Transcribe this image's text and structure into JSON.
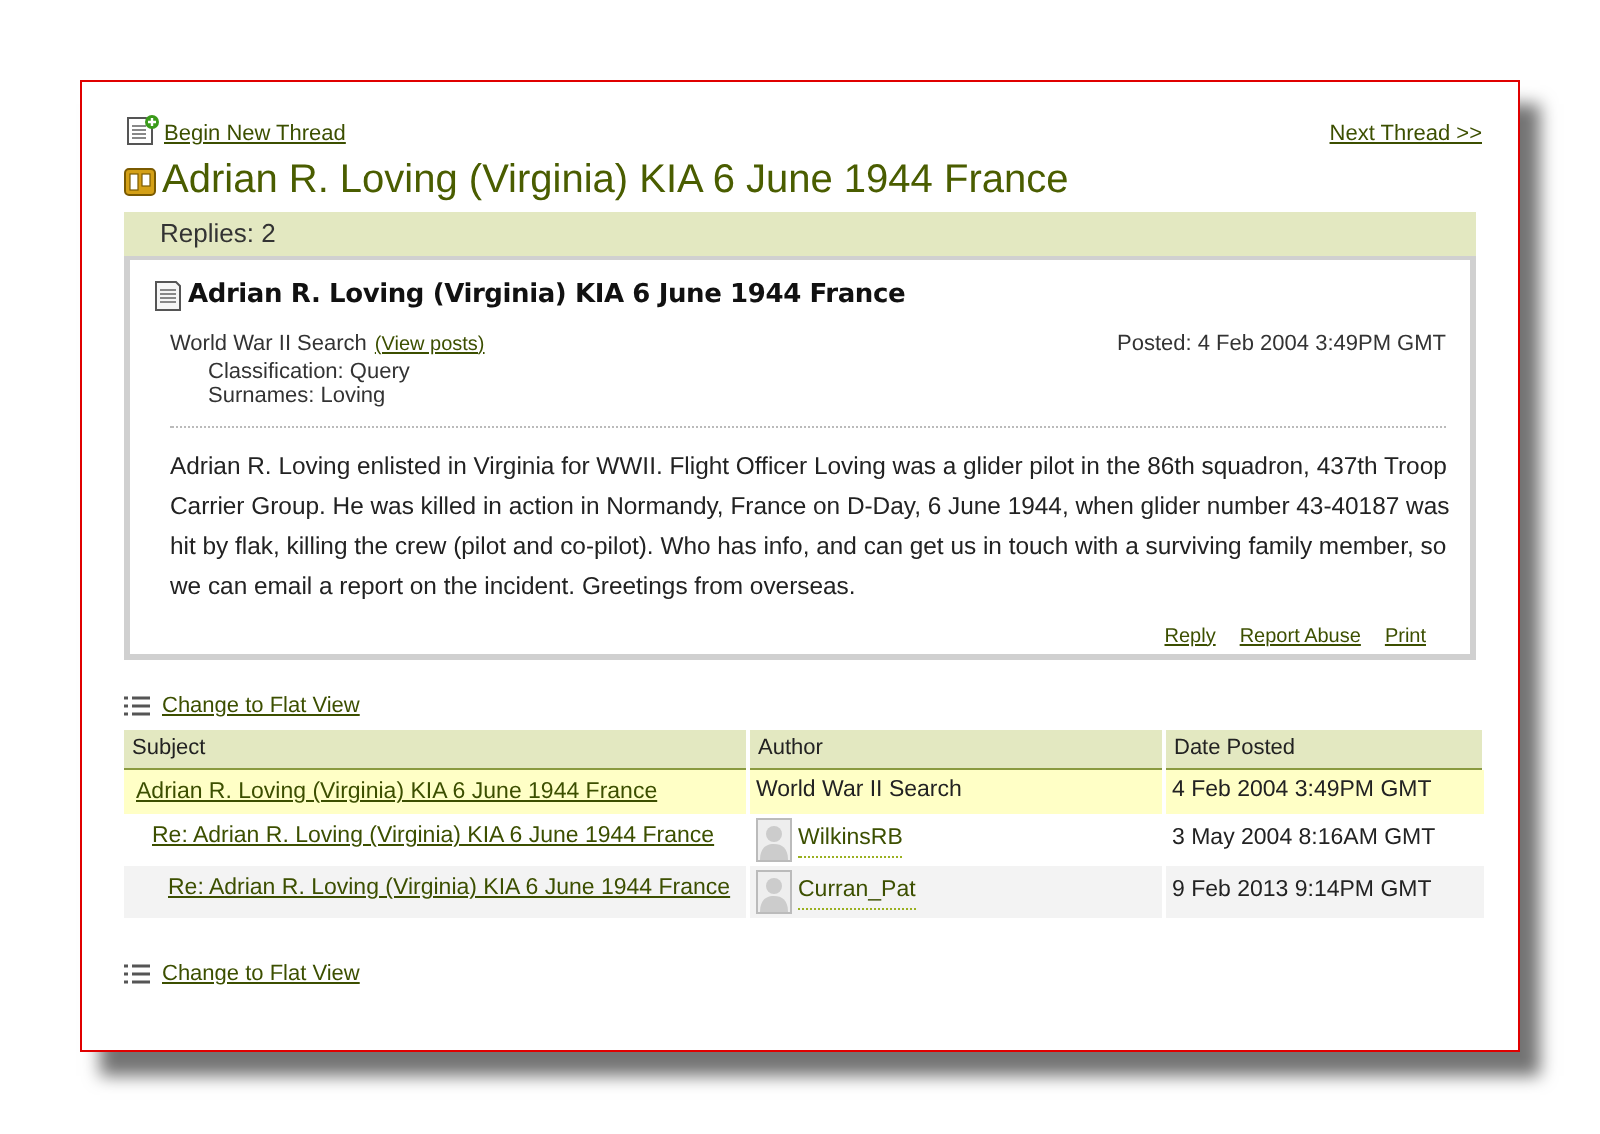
{
  "top_links": {
    "begin_new_thread": "Begin New Thread",
    "next_thread": "Next Thread >>"
  },
  "title": "Adrian R. Loving (Virginia) KIA 6 June 1944 France",
  "replies": "Replies: 2",
  "post": {
    "subject": "Adrian R. Loving (Virginia) KIA 6 June 1944 France",
    "author": "World War II Search",
    "view_posts": "(View posts)",
    "classification": "Classification: Query",
    "surnames": "Surnames: Loving",
    "posted": "Posted: 4 Feb 2004 3:49PM GMT",
    "body": "Adrian R. Loving enlisted in Virginia for WWII. Flight Officer Loving was a glider pilot in the 86th squadron, 437th Troop Carrier Group. He was killed in action in Normandy, France on D-Day, 6 June 1944, when glider number 43-40187 was hit by flak, killing the crew (pilot and co-pilot). Who has info, and can get us in touch with a surviving family member, so we can email a report on the incident. Greetings from overseas.",
    "actions": [
      "Reply",
      "Report Abuse",
      "Print"
    ]
  },
  "flat_view_links": [
    "Change to Flat View",
    "Change to Flat View"
  ],
  "table": {
    "columns": [
      "Subject",
      "Author",
      "Date Posted"
    ],
    "rows": [
      {
        "subject": "Adrian R. Loving (Virginia) KIA 6 June 1944 France",
        "author": {
          "name": "World War II Search",
          "kind": "plain"
        },
        "date": "4 Feb 2004 3:49PM GMT",
        "selected": true,
        "children": [
          {
            "subject": "Re: Adrian R. Loving (Virginia) KIA 6 June 1944 France",
            "author": {
              "name": "WilkinsRB",
              "kind": "member"
            },
            "date": "3 May 2004 8:16AM GMT",
            "selected": false,
            "children": [
              {
                "subject": "Re: Adrian R. Loving (Virginia) KIA 6 June 1944 France",
                "author": {
                  "name": "Curran_Pat",
                  "kind": "member"
                },
                "date": "9 Feb 2013 9:14PM GMT",
                "selected": false
              }
            ]
          }
        ]
      }
    ]
  }
}
